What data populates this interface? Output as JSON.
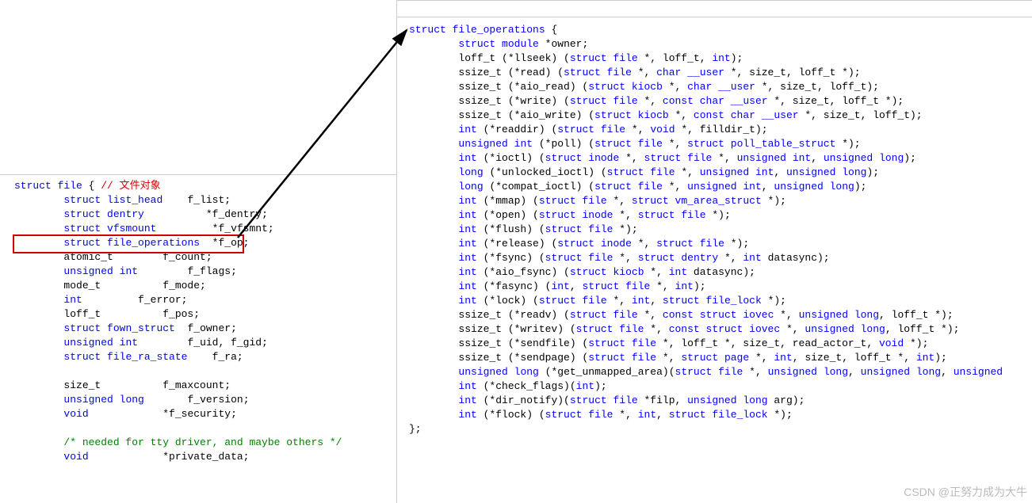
{
  "left": {
    "annotation": "// 文件对象",
    "lines": [
      "struct file {",
      "        struct list_head    f_list;",
      "        struct dentry          *f_dentry;",
      "        struct vfsmount         *f_vfsmnt;",
      "        struct file_operations  *f_op;",
      "        atomic_t        f_count;",
      "        unsigned int        f_flags;",
      "        mode_t          f_mode;",
      "        int         f_error;",
      "        loff_t          f_pos;",
      "        struct fown_struct  f_owner;",
      "        unsigned int        f_uid, f_gid;",
      "        struct file_ra_state    f_ra;",
      "",
      "        size_t          f_maxcount;",
      "        unsigned long       f_version;",
      "        void            *f_security;",
      "",
      "        /* needed for tty driver, and maybe others */",
      "        void            *private_data;"
    ]
  },
  "right": {
    "lines": [
      "struct file_operations {",
      "        struct module *owner;",
      "        loff_t (*llseek) (struct file *, loff_t, int);",
      "        ssize_t (*read) (struct file *, char __user *, size_t, loff_t *);",
      "        ssize_t (*aio_read) (struct kiocb *, char __user *, size_t, loff_t);",
      "        ssize_t (*write) (struct file *, const char __user *, size_t, loff_t *);",
      "        ssize_t (*aio_write) (struct kiocb *, const char __user *, size_t, loff_t);",
      "        int (*readdir) (struct file *, void *, filldir_t);",
      "        unsigned int (*poll) (struct file *, struct poll_table_struct *);",
      "        int (*ioctl) (struct inode *, struct file *, unsigned int, unsigned long);",
      "        long (*unlocked_ioctl) (struct file *, unsigned int, unsigned long);",
      "        long (*compat_ioctl) (struct file *, unsigned int, unsigned long);",
      "        int (*mmap) (struct file *, struct vm_area_struct *);",
      "        int (*open) (struct inode *, struct file *);",
      "        int (*flush) (struct file *);",
      "        int (*release) (struct inode *, struct file *);",
      "        int (*fsync) (struct file *, struct dentry *, int datasync);",
      "        int (*aio_fsync) (struct kiocb *, int datasync);",
      "        int (*fasync) (int, struct file *, int);",
      "        int (*lock) (struct file *, int, struct file_lock *);",
      "        ssize_t (*readv) (struct file *, const struct iovec *, unsigned long, loff_t *);",
      "        ssize_t (*writev) (struct file *, const struct iovec *, unsigned long, loff_t *);",
      "        ssize_t (*sendfile) (struct file *, loff_t *, size_t, read_actor_t, void *);",
      "        ssize_t (*sendpage) (struct file *, struct page *, int, size_t, loff_t *, int);",
      "        unsigned long (*get_unmapped_area)(struct file *, unsigned long, unsigned long, unsigned",
      "        int (*check_flags)(int);",
      "        int (*dir_notify)(struct file *filp, unsigned long arg);",
      "        int (*flock) (struct file *, int, struct file_lock *);",
      "};"
    ]
  },
  "watermark": "CSDN @正努力成为大牛"
}
